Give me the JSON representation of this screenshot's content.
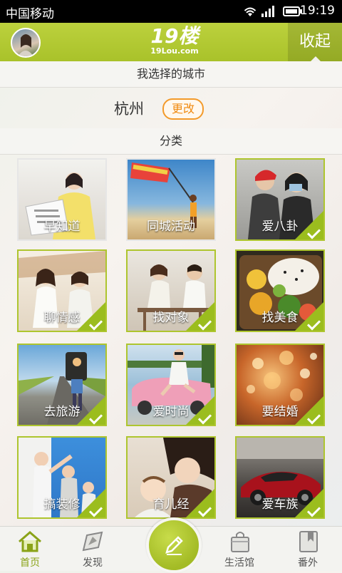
{
  "status_bar": {
    "carrier": "中国移动",
    "time": "19:19"
  },
  "header": {
    "logo_main": "19楼",
    "logo_sub": "19Lou.com",
    "collapse_label": "收起"
  },
  "city_section": {
    "title": "我选择的城市",
    "city": "杭州",
    "change_label": "更改"
  },
  "category_section": {
    "title": "分类",
    "items": [
      {
        "label": "早知道",
        "checked": false
      },
      {
        "label": "同城活动",
        "checked": false
      },
      {
        "label": "爱八卦",
        "checked": true
      },
      {
        "label": "聊情感",
        "checked": true
      },
      {
        "label": "找对象",
        "checked": true
      },
      {
        "label": "找美食",
        "checked": true
      },
      {
        "label": "去旅游",
        "checked": true
      },
      {
        "label": "爱时尚",
        "checked": true
      },
      {
        "label": "要结婚",
        "checked": true
      },
      {
        "label": "搞装修",
        "checked": true
      },
      {
        "label": "育儿经",
        "checked": true
      },
      {
        "label": "爱车族",
        "checked": true
      }
    ]
  },
  "bottom_nav": {
    "items": [
      {
        "label": "首页",
        "icon": "home-icon",
        "active": true
      },
      {
        "label": "发现",
        "icon": "compass-icon"
      },
      {
        "label": "生活馆",
        "icon": "shopping-bag-icon"
      },
      {
        "label": "番外",
        "icon": "bookmark-icon"
      }
    ],
    "compose_icon": "pencil-icon"
  },
  "colors": {
    "accent": "#a9c22a",
    "orange": "#f08a10"
  }
}
